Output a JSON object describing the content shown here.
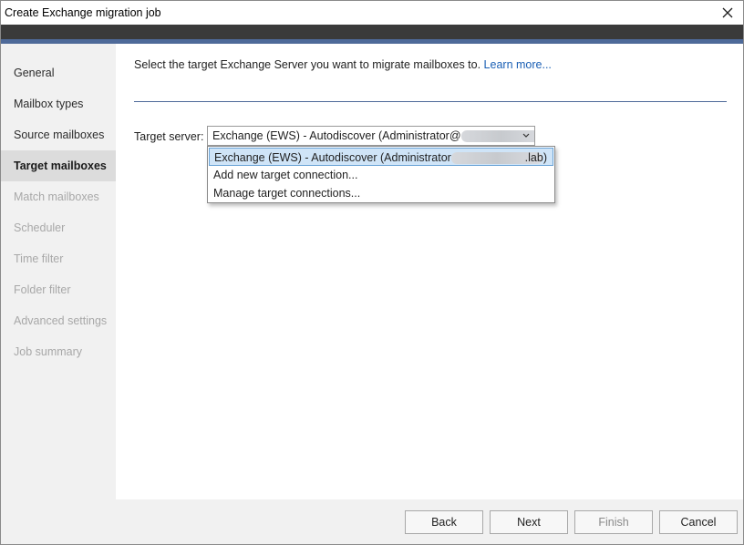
{
  "window": {
    "title": "Create Exchange migration job"
  },
  "sidebar": {
    "items": [
      {
        "label": "General",
        "state": "enabled"
      },
      {
        "label": "Mailbox types",
        "state": "enabled"
      },
      {
        "label": "Source mailboxes",
        "state": "enabled"
      },
      {
        "label": "Target mailboxes",
        "state": "active"
      },
      {
        "label": "Match mailboxes",
        "state": "disabled"
      },
      {
        "label": "Scheduler",
        "state": "disabled"
      },
      {
        "label": "Time filter",
        "state": "disabled"
      },
      {
        "label": "Folder filter",
        "state": "disabled"
      },
      {
        "label": "Advanced settings",
        "state": "disabled"
      },
      {
        "label": "Job summary",
        "state": "disabled"
      }
    ]
  },
  "main": {
    "instruction": "Select the target Exchange Server you want to migrate mailboxes to.",
    "learn_more": "Learn more...",
    "target_label": "Target server:",
    "combo_value": "Exchange (EWS) - Autodiscover (Administrator@",
    "dropdown": {
      "items": [
        {
          "label": "Exchange (EWS) - Autodiscover (Administrator",
          "suffix": ".lab)",
          "selected": true
        },
        {
          "label": "Add new target connection..."
        },
        {
          "label": "Manage target connections..."
        }
      ]
    }
  },
  "footer": {
    "back": "Back",
    "next": "Next",
    "finish": "Finish",
    "cancel": "Cancel"
  },
  "colors": {
    "accent": "#4e6a99",
    "link": "#1a5fb4",
    "selection": "#cfe4f7",
    "sidebar_bg": "#f1f1f1"
  }
}
